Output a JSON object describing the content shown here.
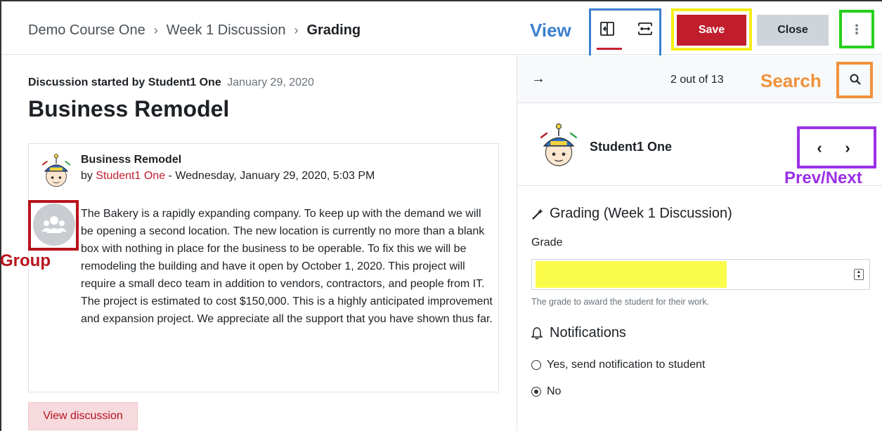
{
  "header": {
    "breadcrumb": [
      "Demo Course One",
      "Week 1 Discussion",
      "Grading"
    ],
    "separator": "›",
    "save_label": "Save",
    "close_label": "Close",
    "more_glyph": "⋮"
  },
  "annotations": {
    "view": "View",
    "search": "Search",
    "prev_next": "Prev/Next",
    "group": "Group",
    "colors": {
      "view": "#3b7fcf",
      "save": "#f5ee16",
      "more": "#24d11c",
      "search": "#f0923c",
      "prev_next": "#9b30e6",
      "group": "#b7131c"
    }
  },
  "discussion": {
    "started_by": "Discussion started by Student1 One",
    "started_date": "January 29, 2020",
    "title": "Business Remodel",
    "post": {
      "title": "Business Remodel",
      "by_prefix": "by ",
      "author": "Student1 One",
      "by_suffix": " - Wednesday, January 29, 2020, 5:03 PM",
      "body": "The Bakery is a rapidly expanding company. To keep up with the demand we will be opening a second location. The new location is currently no more than a blank box with nothing in place for the business to be operable. To fix this we will be remodeling the building and have it open by October 1, 2020. This project will require a small deco team in addition to vendors, contractors, and people from IT. The project is estimated to cost $150,000. This is a highly anticipated improvement and expansion project. We appreciate all the support that you have shown thus far."
    },
    "view_discussion_label": "View discussion"
  },
  "grader": {
    "count_text": "2 out of 13",
    "student_name": "Student1 One",
    "grading_heading": "Grading (Week 1 Discussion)",
    "grade_label": "Grade",
    "grade_value": "",
    "grade_help": "The grade to award the student for their work.",
    "notifications_heading": "Notifications",
    "options": [
      "Yes, send notification to student",
      "No"
    ],
    "selected_option": "No"
  },
  "colors": {
    "primary": "#c11e2d",
    "secondary": "#ced4da",
    "highlight": "#fbfc4a"
  }
}
